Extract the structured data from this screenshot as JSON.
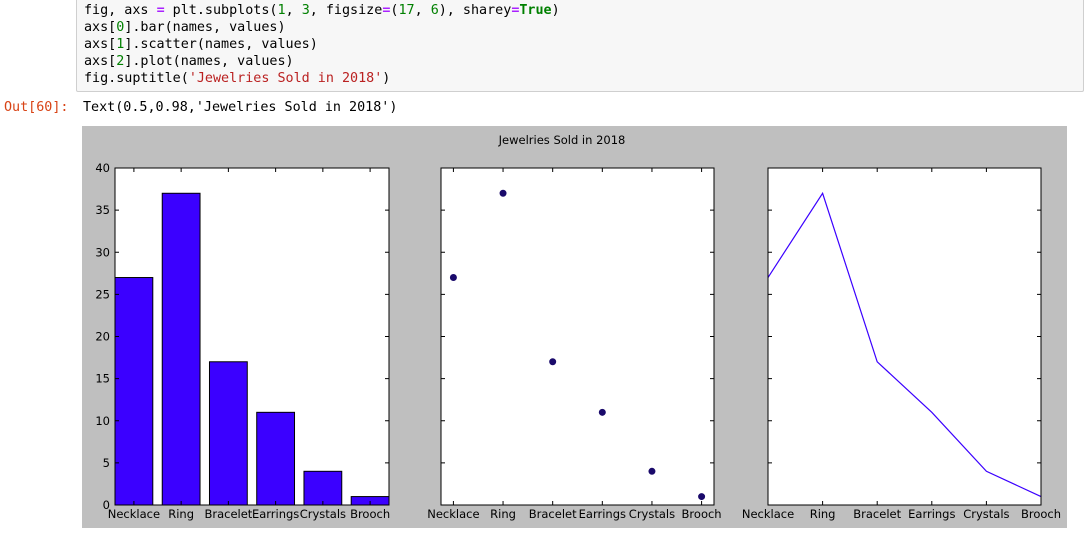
{
  "code": {
    "lines": [
      [
        {
          "t": "fig, axs "
        },
        {
          "t": "=",
          "c": "tok-op"
        },
        {
          "t": " plt.subplots("
        },
        {
          "t": "1",
          "c": "tok-num"
        },
        {
          "t": ", "
        },
        {
          "t": "3",
          "c": "tok-num"
        },
        {
          "t": ", figsize"
        },
        {
          "t": "=",
          "c": "tok-op"
        },
        {
          "t": "("
        },
        {
          "t": "17",
          "c": "tok-num"
        },
        {
          "t": ", "
        },
        {
          "t": "6",
          "c": "tok-num"
        },
        {
          "t": "), sharey"
        },
        {
          "t": "=",
          "c": "tok-op"
        },
        {
          "t": "True",
          "c": "tok-kw"
        },
        {
          "t": ")"
        }
      ],
      [
        {
          "t": "axs["
        },
        {
          "t": "0",
          "c": "tok-num"
        },
        {
          "t": "].bar(names, values)"
        }
      ],
      [
        {
          "t": "axs["
        },
        {
          "t": "1",
          "c": "tok-num"
        },
        {
          "t": "].scatter(names, values)"
        }
      ],
      [
        {
          "t": "axs["
        },
        {
          "t": "2",
          "c": "tok-num"
        },
        {
          "t": "].plot(names, values)"
        }
      ],
      [
        {
          "t": "fig.suptitle("
        },
        {
          "t": "'Jewelries Sold in 2018'",
          "c": "tok-str"
        },
        {
          "t": ")"
        }
      ]
    ]
  },
  "output": {
    "prompt": "Out[60]:",
    "text": "Text(0.5,0.98,'Jewelries Sold in 2018')"
  },
  "chart_data": {
    "title": "Jewelries Sold in 2018",
    "categories": [
      "Necklace",
      "Ring",
      "Bracelet",
      "Earrings",
      "Crystals",
      "Brooch"
    ],
    "values": [
      27,
      37,
      17,
      11,
      4,
      1
    ],
    "ylim": [
      0,
      40
    ],
    "yticks": [
      0,
      5,
      10,
      15,
      20,
      25,
      30,
      35,
      40
    ],
    "color": "#3b00ff",
    "scatter_color": "#1a0a6b",
    "figure_background": "#bfbfbf",
    "subplots": [
      {
        "type": "bar"
      },
      {
        "type": "scatter"
      },
      {
        "type": "line"
      }
    ]
  }
}
